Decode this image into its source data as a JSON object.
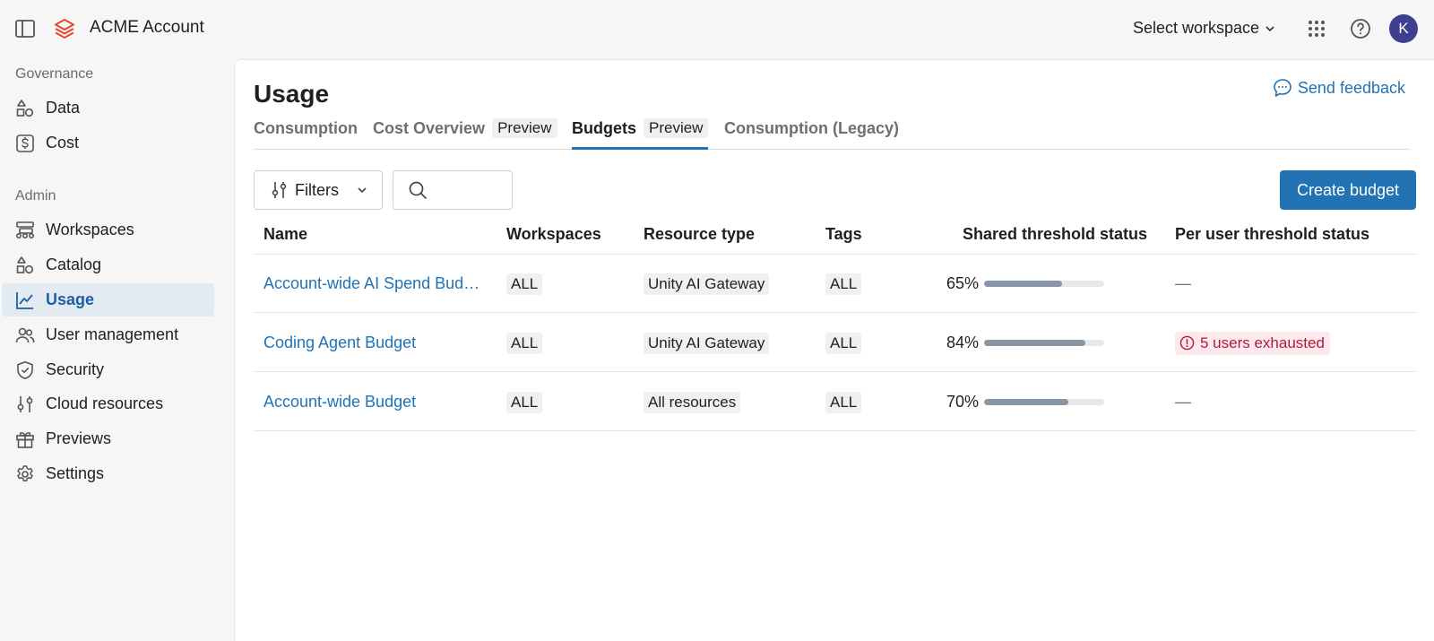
{
  "header": {
    "app_title": "ACME Account",
    "workspace_selector": "Select workspace",
    "avatar_initial": "K"
  },
  "sidebar": {
    "governance_label": "Governance",
    "governance_items": [
      {
        "label": "Data",
        "icon": "shapes-icon"
      },
      {
        "label": "Cost",
        "icon": "dollar-icon"
      }
    ],
    "admin_label": "Admin",
    "admin_items": [
      {
        "label": "Workspaces",
        "icon": "workspaces-icon"
      },
      {
        "label": "Catalog",
        "icon": "shapes-icon"
      },
      {
        "label": "Usage",
        "icon": "line-chart-icon",
        "active": true
      },
      {
        "label": "User management",
        "icon": "users-icon"
      },
      {
        "label": "Security",
        "icon": "shield-icon"
      },
      {
        "label": "Cloud resources",
        "icon": "sliders-icon"
      },
      {
        "label": "Previews",
        "icon": "gift-icon"
      },
      {
        "label": "Settings",
        "icon": "gear-icon"
      }
    ]
  },
  "main": {
    "title": "Usage",
    "feedback_label": "Send feedback",
    "tabs": [
      {
        "label": "Consumption",
        "badge": ""
      },
      {
        "label": "Cost Overview",
        "badge": "Preview"
      },
      {
        "label": "Budgets",
        "badge": "Preview",
        "active": true
      },
      {
        "label": "Consumption (Legacy)",
        "badge": ""
      }
    ],
    "filters_label": "Filters",
    "search_placeholder": "",
    "create_label": "Create budget"
  },
  "table": {
    "columns": [
      "Name",
      "Workspaces",
      "Resource type",
      "Tags",
      "Shared threshold status",
      "Per user threshold status"
    ],
    "rows": [
      {
        "name": "Account-wide AI Spend Budget",
        "workspaces": "ALL",
        "resource_type": "Unity AI Gateway",
        "tags": "ALL",
        "shared_pct": "65%",
        "shared_fraction": 0.65,
        "per_user": "—",
        "per_user_alert": false
      },
      {
        "name": "Coding Agent Budget",
        "workspaces": "ALL",
        "resource_type": "Unity AI Gateway",
        "tags": "ALL",
        "shared_pct": "84%",
        "shared_fraction": 0.84,
        "per_user": "5 users exhausted",
        "per_user_alert": true
      },
      {
        "name": "Account-wide Budget",
        "workspaces": "ALL",
        "resource_type": "All resources",
        "tags": "ALL",
        "shared_pct": "70%",
        "shared_fraction": 0.7,
        "per_user": "—",
        "per_user_alert": false
      }
    ]
  },
  "colors": {
    "accent": "#2272b4",
    "link": "#1f73b7",
    "active_nav_bg": "#e3ebf2",
    "progress_fill": "#8796a5",
    "alert_text": "#b01c3d",
    "alert_bg": "#fbe9ee",
    "avatar_bg": "#3f3f8f"
  }
}
